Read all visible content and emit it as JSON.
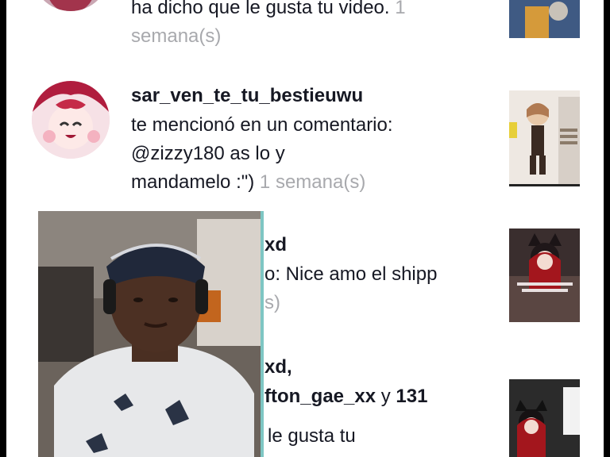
{
  "notifications": [
    {
      "username": "",
      "message": "ha dicho que le gusta tu video.",
      "time": "1 semana(s)"
    },
    {
      "username": "sar_ven_te_tu_bestieuwu",
      "message_line1": "te mencionó en un comentario:",
      "message_line2": "@zizzy180 as lo y",
      "message_line3": "mandamelo :\")",
      "time": "1 semana(s)"
    },
    {
      "username_partial": "xd",
      "message_partial": "o: Nice amo el shipp",
      "time_partial": "s)"
    },
    {
      "username_partial": "xd,",
      "others_prefix": "fton_gae_xx",
      "others_joiner": "y",
      "others_count": "131",
      "message_partial": "le gusta tu"
    }
  ],
  "overlay": {
    "icon": "webcam-overlay"
  }
}
